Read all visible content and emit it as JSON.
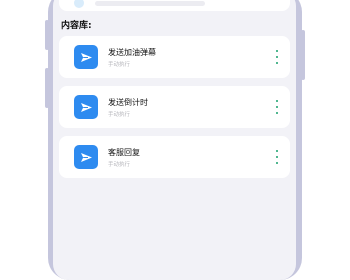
{
  "section": {
    "title": "内容库:"
  },
  "items": [
    {
      "title": "发送加油弹幕",
      "subtitle": "手动执行",
      "icon": "send-icon"
    },
    {
      "title": "发送倒计时",
      "subtitle": "手动执行",
      "icon": "send-icon"
    },
    {
      "title": "客服回复",
      "subtitle": "手动执行",
      "icon": "send-icon"
    }
  ],
  "colors": {
    "accent": "#2e8bf0",
    "more": "#1aa06d",
    "frame": "#c5c6dd",
    "screen_bg": "#f2f2f7"
  }
}
